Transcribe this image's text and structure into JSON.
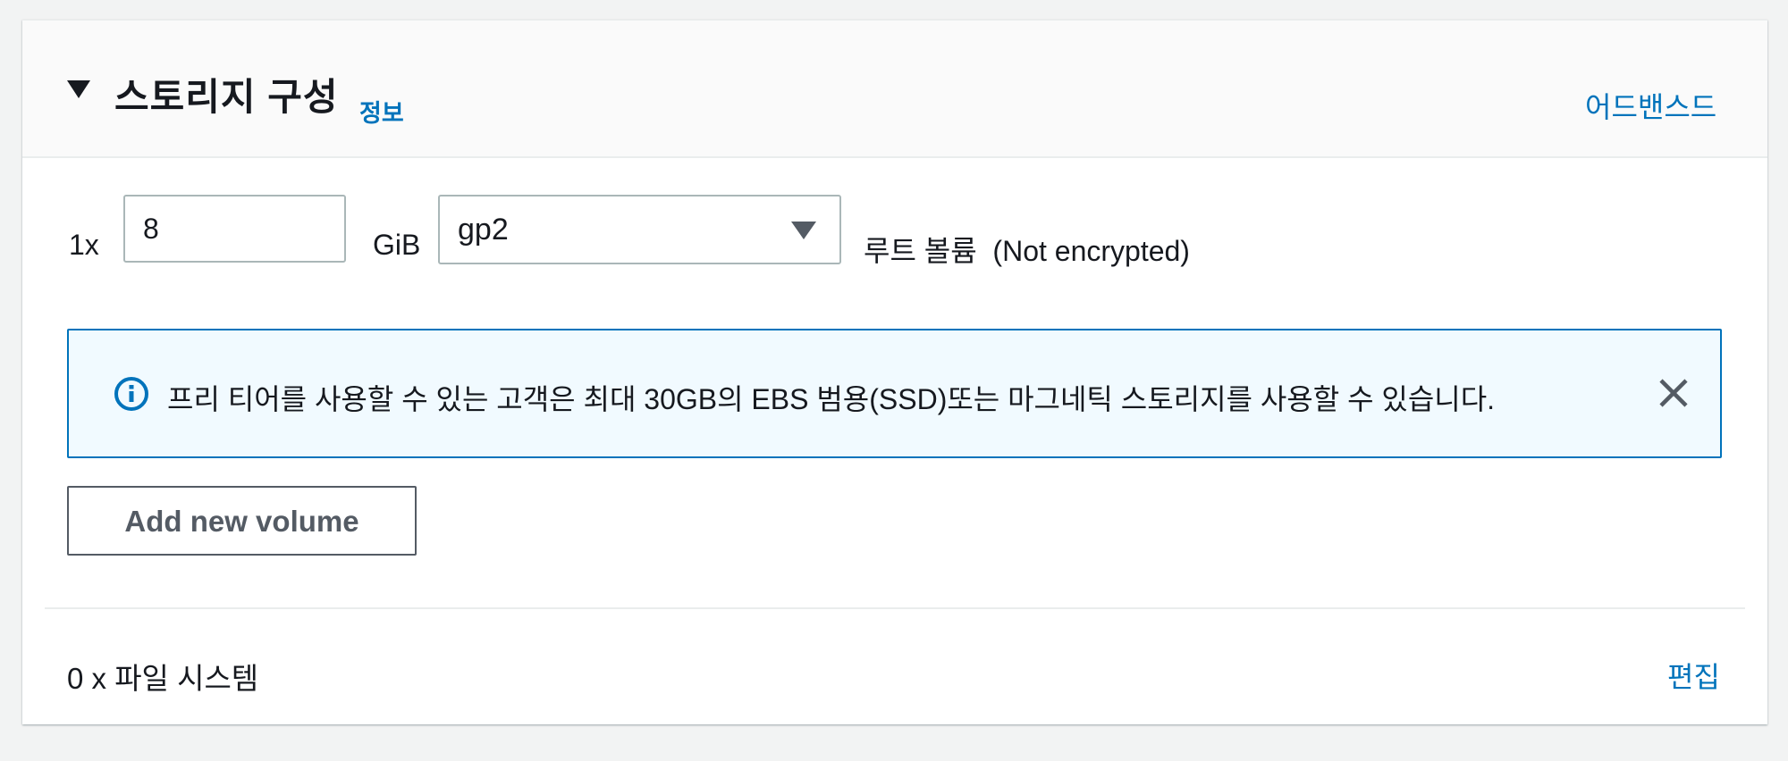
{
  "header": {
    "title": "스토리지 구성",
    "info_link": "정보",
    "advanced_link": "어드밴스드"
  },
  "volume": {
    "multiplier": "1x",
    "size_value": "8",
    "unit": "GiB",
    "volume_type": "gp2",
    "root_label": "루트 볼륨  (Not encrypted)"
  },
  "alert": {
    "text": "프리 티어를 사용할 수 있는 고객은 최대 30GB의 EBS 범용(SSD)또는 마그네틱 스토리지를 사용할 수 있습니다.",
    "icon": "info-icon",
    "close_icon": "close-icon"
  },
  "actions": {
    "add_volume_label": "Add new volume"
  },
  "file_systems": {
    "label": "0 x 파일 시스템",
    "edit_link": "편집"
  },
  "colors": {
    "link": "#0073bb",
    "alert_bg": "#f1faff",
    "alert_border": "#0073bb"
  }
}
